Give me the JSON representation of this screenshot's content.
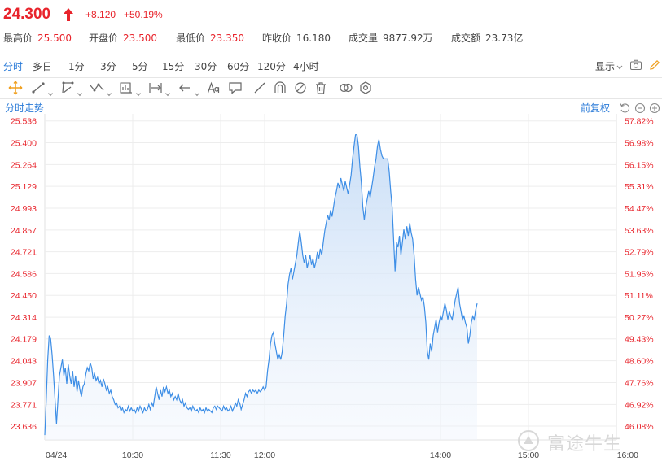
{
  "quote": {
    "price": "24.300",
    "change": "+8.120",
    "change_pct": "+50.19%",
    "stats": [
      {
        "label": "最高价",
        "value": "25.500",
        "tone": "red"
      },
      {
        "label": "开盘价",
        "value": "23.500",
        "tone": "red"
      },
      {
        "label": "最低价",
        "value": "23.350",
        "tone": "red"
      },
      {
        "label": "昨收价",
        "value": "16.180",
        "tone": "plain"
      },
      {
        "label": "成交量",
        "value": "9877.92万",
        "tone": "plain"
      },
      {
        "label": "成交额",
        "value": "23.73亿",
        "tone": "plain"
      }
    ]
  },
  "period_tabs": [
    "分时",
    "多日",
    "1分",
    "3分",
    "5分",
    "15分",
    "30分",
    "60分",
    "120分",
    "4小时"
  ],
  "active_tab": "分时",
  "display_label": "显示",
  "toolbar_icons": [
    "crosshair-icon",
    "trendline-icon",
    "polyline-icon",
    "zigzag-icon",
    "measure-icon",
    "range-icon",
    "arrow-icon",
    "text-icon",
    "comment-icon",
    "brush-icon",
    "magnet-icon",
    "hide-icon",
    "trash-icon",
    "link-icon",
    "settings-icon"
  ],
  "chart_panel": {
    "title": "分时走势",
    "adjust_label": "前复权"
  },
  "watermark": "富途牛生",
  "colors": {
    "accent": "#2b7bd8",
    "up": "#e8232b",
    "line": "#3d8ee6",
    "fill_top": "#c6dcf6",
    "grid": "#ececec"
  },
  "chart_data": {
    "type": "area",
    "title": "",
    "xlabel": "",
    "ylabel": "",
    "prev_close": 16.18,
    "ylim": [
      23.55,
      25.58
    ],
    "left_ticks": [
      "25.536",
      "25.400",
      "25.264",
      "25.129",
      "24.993",
      "24.857",
      "24.721",
      "24.586",
      "24.450",
      "24.314",
      "24.179",
      "24.043",
      "23.907",
      "23.771",
      "23.636"
    ],
    "right_ticks": [
      "57.82%",
      "56.98%",
      "56.15%",
      "55.31%",
      "54.47%",
      "53.63%",
      "52.79%",
      "51.95%",
      "51.11%",
      "50.27%",
      "49.43%",
      "48.60%",
      "47.76%",
      "46.92%",
      "46.08%"
    ],
    "x_labels": [
      "04/24",
      "10:30",
      "11:30",
      "12:00",
      "14:00",
      "15:00",
      "16:00"
    ],
    "x_label_minutes": [
      0,
      60,
      120,
      150,
      270,
      330,
      390
    ],
    "grid": true,
    "series": [
      {
        "values": [
          [
            0,
            23.58
          ],
          [
            1,
            23.8
          ],
          [
            2,
            24.05
          ],
          [
            3,
            24.2
          ],
          [
            4,
            24.18
          ],
          [
            5,
            24.08
          ],
          [
            6,
            23.95
          ],
          [
            7,
            23.8
          ],
          [
            8,
            23.65
          ],
          [
            9,
            23.8
          ],
          [
            10,
            23.95
          ],
          [
            11,
            24.0
          ],
          [
            12,
            24.05
          ],
          [
            13,
            23.95
          ],
          [
            14,
            24.0
          ],
          [
            15,
            23.9
          ],
          [
            16,
            24.02
          ],
          [
            17,
            23.95
          ],
          [
            18,
            23.9
          ],
          [
            19,
            23.98
          ],
          [
            20,
            23.88
          ],
          [
            21,
            23.95
          ],
          [
            22,
            23.85
          ],
          [
            23,
            23.92
          ],
          [
            24,
            23.86
          ],
          [
            25,
            23.82
          ],
          [
            26,
            23.88
          ],
          [
            27,
            23.9
          ],
          [
            28,
            23.96
          ],
          [
            29,
            24.0
          ],
          [
            30,
            23.98
          ],
          [
            31,
            24.03
          ],
          [
            32,
            24.0
          ],
          [
            33,
            23.93
          ],
          [
            34,
            23.96
          ],
          [
            35,
            23.92
          ],
          [
            36,
            23.94
          ],
          [
            37,
            23.9
          ],
          [
            38,
            23.92
          ],
          [
            39,
            23.88
          ],
          [
            40,
            23.93
          ],
          [
            41,
            23.9
          ],
          [
            42,
            23.86
          ],
          [
            43,
            23.88
          ],
          [
            44,
            23.84
          ],
          [
            45,
            23.86
          ],
          [
            46,
            23.82
          ],
          [
            47,
            23.8
          ],
          [
            48,
            23.77
          ],
          [
            49,
            23.78
          ],
          [
            50,
            23.75
          ],
          [
            51,
            23.76
          ],
          [
            52,
            23.73
          ],
          [
            53,
            23.75
          ],
          [
            54,
            23.72
          ],
          [
            55,
            23.74
          ],
          [
            56,
            23.73
          ],
          [
            57,
            23.76
          ],
          [
            58,
            23.73
          ],
          [
            59,
            23.75
          ],
          [
            60,
            23.73
          ],
          [
            61,
            23.74
          ],
          [
            62,
            23.72
          ],
          [
            63,
            23.75
          ],
          [
            64,
            23.73
          ],
          [
            65,
            23.76
          ],
          [
            66,
            23.74
          ],
          [
            67,
            23.72
          ],
          [
            68,
            23.75
          ],
          [
            69,
            23.73
          ],
          [
            70,
            23.74
          ],
          [
            71,
            23.77
          ],
          [
            72,
            23.74
          ],
          [
            73,
            23.78
          ],
          [
            74,
            23.76
          ],
          [
            75,
            23.82
          ],
          [
            76,
            23.88
          ],
          [
            77,
            23.84
          ],
          [
            78,
            23.8
          ],
          [
            79,
            23.86
          ],
          [
            80,
            23.82
          ],
          [
            81,
            23.88
          ],
          [
            82,
            23.85
          ],
          [
            83,
            23.88
          ],
          [
            84,
            23.84
          ],
          [
            85,
            23.86
          ],
          [
            86,
            23.82
          ],
          [
            87,
            23.84
          ],
          [
            88,
            23.8
          ],
          [
            89,
            23.82
          ],
          [
            90,
            23.8
          ],
          [
            91,
            23.84
          ],
          [
            92,
            23.8
          ],
          [
            93,
            23.78
          ],
          [
            94,
            23.8
          ],
          [
            95,
            23.76
          ],
          [
            96,
            23.78
          ],
          [
            97,
            23.75
          ],
          [
            98,
            23.74
          ],
          [
            99,
            23.75
          ],
          [
            100,
            23.73
          ],
          [
            101,
            23.76
          ],
          [
            102,
            23.74
          ],
          [
            103,
            23.73
          ],
          [
            104,
            23.74
          ],
          [
            105,
            23.72
          ],
          [
            106,
            23.75
          ],
          [
            107,
            23.73
          ],
          [
            108,
            23.74
          ],
          [
            109,
            23.72
          ],
          [
            110,
            23.75
          ],
          [
            111,
            23.73
          ],
          [
            112,
            23.74
          ],
          [
            113,
            23.73
          ],
          [
            114,
            23.72
          ],
          [
            115,
            23.75
          ],
          [
            116,
            23.76
          ],
          [
            117,
            23.74
          ],
          [
            118,
            23.76
          ],
          [
            119,
            23.75
          ],
          [
            120,
            23.74
          ],
          [
            121,
            23.73
          ],
          [
            122,
            23.76
          ],
          [
            123,
            23.74
          ],
          [
            124,
            23.75
          ],
          [
            125,
            23.73
          ],
          [
            126,
            23.74
          ],
          [
            127,
            23.76
          ],
          [
            128,
            23.73
          ],
          [
            129,
            23.75
          ],
          [
            130,
            23.78
          ],
          [
            131,
            23.76
          ],
          [
            132,
            23.8
          ],
          [
            133,
            23.78
          ],
          [
            134,
            23.74
          ],
          [
            135,
            23.77
          ],
          [
            136,
            23.8
          ],
          [
            137,
            23.84
          ],
          [
            138,
            23.82
          ],
          [
            139,
            23.85
          ],
          [
            140,
            23.86
          ],
          [
            141,
            23.84
          ],
          [
            142,
            23.86
          ],
          [
            143,
            23.85
          ],
          [
            144,
            23.86
          ],
          [
            145,
            23.84
          ],
          [
            146,
            23.86
          ],
          [
            147,
            23.85
          ],
          [
            148,
            23.86
          ],
          [
            149,
            23.88
          ],
          [
            150,
            23.86
          ],
          [
            151,
            23.88
          ],
          [
            152,
            23.98
          ],
          [
            153,
            24.05
          ],
          [
            154,
            24.15
          ],
          [
            155,
            24.2
          ],
          [
            156,
            24.22
          ],
          [
            157,
            24.15
          ],
          [
            158,
            24.1
          ],
          [
            159,
            24.05
          ],
          [
            160,
            24.08
          ],
          [
            161,
            24.05
          ],
          [
            162,
            24.1
          ],
          [
            163,
            24.2
          ],
          [
            164,
            24.32
          ],
          [
            165,
            24.4
          ],
          [
            166,
            24.52
          ],
          [
            167,
            24.58
          ],
          [
            168,
            24.62
          ],
          [
            169,
            24.55
          ],
          [
            170,
            24.6
          ],
          [
            171,
            24.65
          ],
          [
            172,
            24.7
          ],
          [
            173,
            24.78
          ],
          [
            174,
            24.85
          ],
          [
            175,
            24.78
          ],
          [
            176,
            24.7
          ],
          [
            177,
            24.65
          ],
          [
            178,
            24.7
          ],
          [
            179,
            24.62
          ],
          [
            180,
            24.66
          ],
          [
            181,
            24.7
          ],
          [
            182,
            24.64
          ],
          [
            183,
            24.68
          ],
          [
            184,
            24.62
          ],
          [
            185,
            24.66
          ],
          [
            186,
            24.72
          ],
          [
            187,
            24.68
          ],
          [
            188,
            24.74
          ],
          [
            189,
            24.7
          ],
          [
            190,
            24.78
          ],
          [
            191,
            24.85
          ],
          [
            192,
            24.9
          ],
          [
            193,
            24.95
          ],
          [
            194,
            24.92
          ],
          [
            195,
            24.98
          ],
          [
            196,
            24.94
          ],
          [
            197,
            25.0
          ],
          [
            198,
            25.06
          ],
          [
            199,
            25.1
          ],
          [
            200,
            25.15
          ],
          [
            201,
            25.12
          ],
          [
            202,
            25.18
          ],
          [
            203,
            25.14
          ],
          [
            204,
            25.1
          ],
          [
            205,
            25.16
          ],
          [
            206,
            25.12
          ],
          [
            207,
            25.08
          ],
          [
            208,
            25.14
          ],
          [
            209,
            25.2
          ],
          [
            210,
            25.3
          ],
          [
            211,
            25.38
          ],
          [
            212,
            25.45
          ],
          [
            213,
            25.45
          ],
          [
            214,
            25.38
          ],
          [
            215,
            25.25
          ],
          [
            216,
            25.15
          ],
          [
            217,
            25.0
          ],
          [
            218,
            24.92
          ],
          [
            219,
            25.0
          ],
          [
            220,
            25.05
          ],
          [
            221,
            25.1
          ],
          [
            222,
            25.06
          ],
          [
            223,
            25.12
          ],
          [
            224,
            25.18
          ],
          [
            225,
            25.25
          ],
          [
            226,
            25.3
          ],
          [
            227,
            25.38
          ],
          [
            228,
            25.42
          ],
          [
            229,
            25.36
          ],
          [
            230,
            25.32
          ],
          [
            231,
            25.3
          ],
          [
            232,
            25.3
          ],
          [
            233,
            25.3
          ],
          [
            234,
            25.3
          ],
          [
            235,
            25.22
          ],
          [
            236,
            25.1
          ],
          [
            237,
            25.0
          ],
          [
            238,
            24.8
          ],
          [
            239,
            24.6
          ],
          [
            240,
            24.78
          ],
          [
            241,
            24.75
          ],
          [
            242,
            24.82
          ],
          [
            243,
            24.7
          ],
          [
            244,
            24.78
          ],
          [
            245,
            24.86
          ],
          [
            246,
            24.8
          ],
          [
            247,
            24.88
          ],
          [
            248,
            24.82
          ],
          [
            249,
            24.9
          ],
          [
            250,
            24.84
          ],
          [
            251,
            24.8
          ],
          [
            252,
            24.7
          ],
          [
            253,
            24.55
          ],
          [
            254,
            24.45
          ],
          [
            255,
            24.5
          ],
          [
            256,
            24.46
          ],
          [
            257,
            24.42
          ],
          [
            258,
            24.44
          ],
          [
            259,
            24.38
          ],
          [
            260,
            24.28
          ],
          [
            261,
            24.1
          ],
          [
            262,
            24.05
          ],
          [
            263,
            24.15
          ],
          [
            264,
            24.1
          ],
          [
            265,
            24.2
          ],
          [
            266,
            24.25
          ],
          [
            267,
            24.3
          ],
          [
            268,
            24.22
          ],
          [
            269,
            24.28
          ],
          [
            270,
            24.32
          ],
          [
            271,
            24.3
          ],
          [
            272,
            24.35
          ],
          [
            273,
            24.4
          ],
          [
            274,
            24.36
          ],
          [
            275,
            24.3
          ],
          [
            276,
            24.35
          ],
          [
            277,
            24.32
          ],
          [
            278,
            24.3
          ],
          [
            279,
            24.36
          ],
          [
            280,
            24.42
          ],
          [
            281,
            24.46
          ],
          [
            282,
            24.5
          ],
          [
            283,
            24.4
          ],
          [
            284,
            24.35
          ],
          [
            285,
            24.3
          ],
          [
            286,
            24.32
          ],
          [
            287,
            24.28
          ],
          [
            288,
            24.25
          ],
          [
            289,
            24.15
          ],
          [
            290,
            24.2
          ],
          [
            291,
            24.28
          ],
          [
            292,
            24.32
          ],
          [
            293,
            24.3
          ],
          [
            294,
            24.36
          ],
          [
            295,
            24.4
          ]
        ]
      }
    ]
  }
}
